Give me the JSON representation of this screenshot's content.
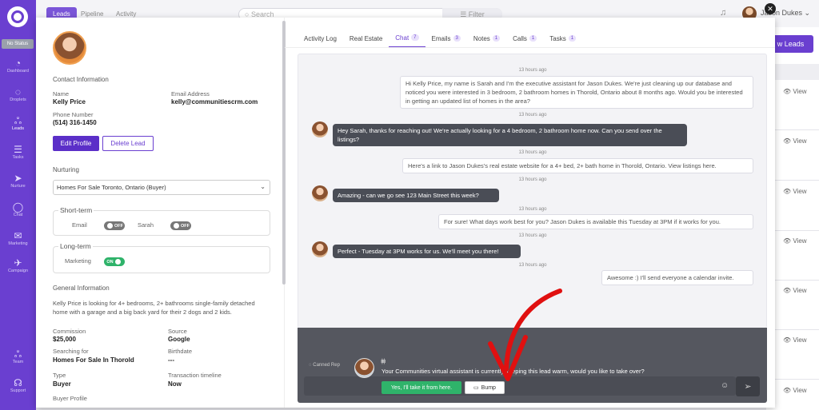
{
  "rail": {
    "status": "No Status",
    "items": [
      {
        "label": "Dashboard",
        "icon": "dashboard-icon",
        "glyph": "◔"
      },
      {
        "label": "Droplets",
        "icon": "droplet-icon",
        "glyph": "◌"
      },
      {
        "label": "Leads",
        "icon": "people-icon",
        "glyph": "ஃ"
      },
      {
        "label": "Tasks",
        "icon": "tasks-icon",
        "glyph": "☰"
      },
      {
        "label": "Nurture",
        "icon": "send-icon",
        "glyph": "➤"
      },
      {
        "label": "Chat",
        "icon": "chat-icon",
        "glyph": "◯"
      },
      {
        "label": "Marketing",
        "icon": "mail-icon",
        "glyph": "✉"
      },
      {
        "label": "Campaign",
        "icon": "rocket-icon",
        "glyph": "✈"
      },
      {
        "label": "Team",
        "icon": "team-icon",
        "glyph": "ஃ"
      },
      {
        "label": "Support",
        "icon": "headset-icon",
        "glyph": "☊"
      }
    ]
  },
  "topbar": {
    "tabs": [
      "Leads",
      "Pipeline",
      "Activity"
    ],
    "search_placeholder": "Search",
    "filter": "Filter",
    "user": "Jason Dukes"
  },
  "background": {
    "new_leads": "w Leads",
    "view": "View"
  },
  "contact": {
    "section": "Contact Information",
    "name_label": "Name",
    "name": "Kelly Price",
    "email_label": "Email Address",
    "email": "kelly@communitiescrm.com",
    "phone_label": "Phone Number",
    "phone": "(514) 316-1450",
    "edit": "Edit Profile",
    "delete": "Delete Lead"
  },
  "nurturing": {
    "label": "Nurturing",
    "selected": "Homes For Sale Toronto, Ontario (Buyer)",
    "short_term": "Short-term",
    "email": "Email",
    "email_state": "OFF",
    "sarah": "Sarah",
    "sarah_state": "OFF",
    "long_term": "Long-term",
    "marketing": "Marketing",
    "marketing_state": "ON"
  },
  "general": {
    "section": "General Information",
    "description": "Kelly Price is looking for 4+ bedrooms, 2+ bathrooms single-family detached home with a garage and a big back yard for their 2 dogs and 2 kids.",
    "commission_label": "Commission",
    "commission": "$25,000",
    "source_label": "Source",
    "source": "Google",
    "searching_label": "Searching for",
    "searching": "Homes For Sale In Thorold",
    "birthdate_label": "Birthdate",
    "birthdate": "---",
    "type_label": "Type",
    "type": "Buyer",
    "timeline_label": "Transaction timeline",
    "timeline": "Now",
    "buyer_profile": "Buyer Profile"
  },
  "tabs": [
    {
      "label": "Activity Log",
      "count": ""
    },
    {
      "label": "Real Estate",
      "count": ""
    },
    {
      "label": "Chat",
      "count": "7"
    },
    {
      "label": "Emails",
      "count": "3"
    },
    {
      "label": "Notes",
      "count": "1"
    },
    {
      "label": "Calls",
      "count": "1"
    },
    {
      "label": "Tasks",
      "count": "1"
    }
  ],
  "chat": {
    "messages": [
      {
        "time": "13 hours ago",
        "text": "Hi Kelly Price, my name is Sarah and I'm the executive assistant for Jason Dukes. We're just cleaning up our database and noticed you were interested in 3 bedroom, 2 bathroom homes in Thorold, Ontario about 8 months ago. Would you be interested in getting an updated list of homes in the area?"
      },
      {
        "time": "13 hours ago",
        "text": "Hey Sarah, thanks for reaching out! We're actually looking for a 4 bedroom, 2 bathroom home now. Can you send over the listings?"
      },
      {
        "time": "13 hours ago",
        "text": "Here's a link to Jason Dukes's real estate website for a 4+ bed, 2+ bath home in Thorold, Ontario. View listings here."
      },
      {
        "time": "13 hours ago",
        "text": "Amazing - can we go see 123 Main Street this week?"
      },
      {
        "time": "13 hours ago",
        "text": "For sure! What days work best for you? Jason Dukes is available this Tuesday at 3PM if it works for you."
      },
      {
        "time": "13 hours ago",
        "text": "Perfect - Tuesday at 3PM works for us. We'll meet you there!"
      },
      {
        "time": "13 hours ago",
        "text": "Awesome :) I'll send everyone a calendar invite."
      }
    ]
  },
  "composer": {
    "canned": "Canned Rep",
    "assistant_text": "Your Communities virtual assistant is currently keeping this lead warm, would you like to take over?",
    "take_over": "Yes, I'll take it from here.",
    "bump": "Bump"
  },
  "colors": {
    "brand": "#6a3fd0",
    "success": "#2fb36a",
    "annotation_arrow": "#e01010"
  }
}
